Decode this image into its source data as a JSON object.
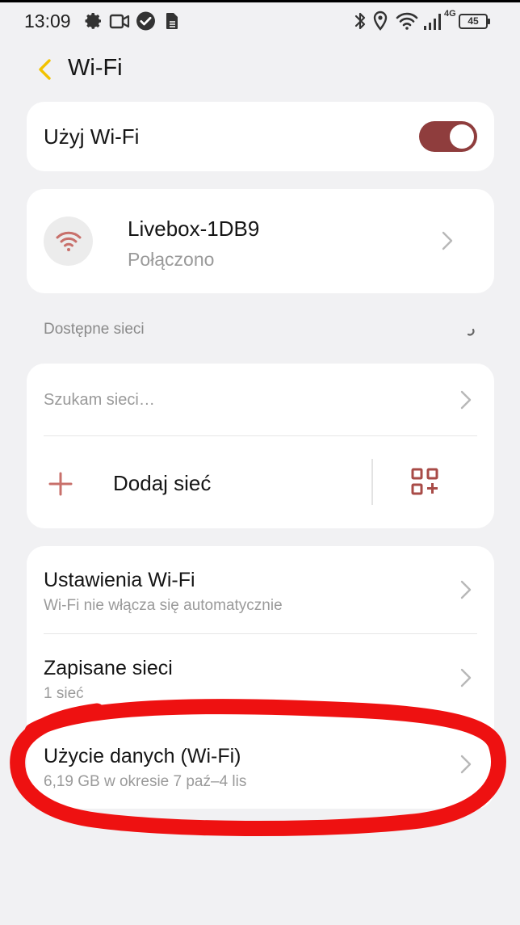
{
  "status_bar": {
    "time": "13:09",
    "network_type": "4G",
    "battery": "45",
    "left_icons": [
      "gear-icon",
      "video-icon",
      "check-circle-icon",
      "sim-icon"
    ],
    "right_icons": [
      "bluetooth-icon",
      "location-icon",
      "wifi-icon",
      "signal-icon",
      "battery-icon"
    ]
  },
  "header": {
    "title": "Wi-Fi",
    "back_icon": "chevron-left-icon"
  },
  "wifi_toggle": {
    "label": "Użyj Wi-Fi",
    "enabled": true
  },
  "connected_network": {
    "name": "Livebox-1DB9",
    "status": "Połączono"
  },
  "available_section": {
    "title": "Dostępne sieci",
    "searching_text": "Szukam sieci…",
    "add_network_label": "Dodaj sieć"
  },
  "settings_list": [
    {
      "title": "Ustawienia Wi-Fi",
      "subtitle": "Wi-Fi nie włącza się automatycznie"
    },
    {
      "title": "Zapisane sieci",
      "subtitle": "1 sieć"
    },
    {
      "title": "Użycie danych (Wi-Fi)",
      "subtitle": "6,19 GB w okresie 7 paź–4 lis"
    }
  ],
  "colors": {
    "accent_yellow": "#f2c200",
    "toggle_on": "#8f3d3d",
    "icon_red": "#c8706b",
    "annotation_red": "#ee1111"
  }
}
